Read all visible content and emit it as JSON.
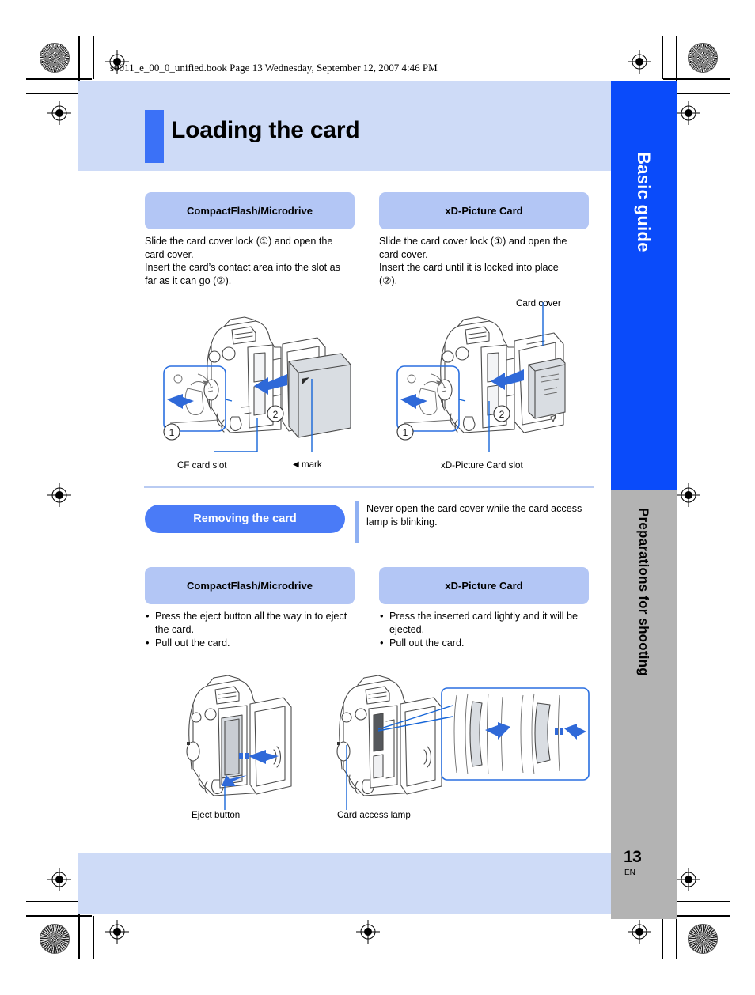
{
  "running_head": "s0011_e_00_0_unified.book  Page 13  Wednesday, September 12, 2007  4:46 PM",
  "header": {
    "title": "Loading the card",
    "accent_color": "#3b71f7",
    "band_color": "#cedbf7"
  },
  "tabs": {
    "basic": {
      "label": "Basic guide",
      "color": "#0a4bfa"
    },
    "preparations": {
      "label": "Preparations for shooting",
      "color": "#b3b3b3"
    }
  },
  "page_number": "13",
  "page_language": "EN",
  "loading_section": {
    "left": {
      "heading": "CompactFlash/Microdrive",
      "lines": [
        "Slide the card cover lock (①) and open the",
        "card cover.",
        "Insert the card’s contact area into the slot as",
        "far as it can go (②)."
      ]
    },
    "right": {
      "heading": "xD-Picture Card",
      "lines": [
        "Slide the card cover lock (①) and open the",
        "card cover.",
        "Insert the card until it is locked into place",
        "(②)."
      ]
    },
    "captions": {
      "cf_card_slot": "CF card slot",
      "mark": "mark",
      "mark_glyph": "◀",
      "card_cover": "Card cover",
      "xd_card_slot": "xD-Picture Card slot"
    },
    "callout_numbers": [
      "1",
      "2"
    ]
  },
  "removing_section": {
    "heading": "Removing the card",
    "note": "Never open the card cover while the card access lamp is blinking.",
    "left": {
      "heading": "CompactFlash/Microdrive",
      "bullets": [
        "Press the eject button all the way in to eject the card.",
        "Pull out the card."
      ]
    },
    "right": {
      "heading": "xD-Picture Card",
      "bullets": [
        "Press the inserted card lightly and it will be ejected.",
        "Pull out the card."
      ]
    },
    "captions": {
      "eject_button": "Eject button",
      "card_access_lamp": "Card access lamp"
    }
  },
  "colors": {
    "pill_light": "#b3c6f5",
    "pill_solid": "#4a7bf7",
    "rule": "#b9cbf2",
    "diagram_blue": "#2f69d8"
  },
  "print_marks": {
    "registration_icon": "registration-target-icon",
    "rosette_icon": "color-rosette-icon",
    "crop_icon": "crop-mark-icon"
  }
}
